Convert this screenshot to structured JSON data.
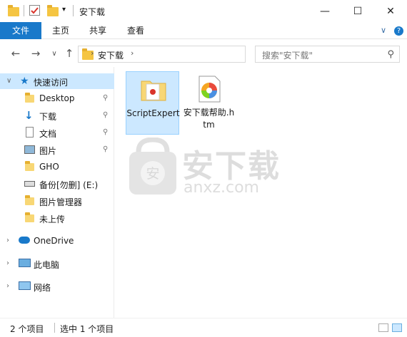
{
  "window": {
    "title": "安下载",
    "minimize_glyph": "—",
    "maximize_glyph": "☐",
    "close_glyph": "✕"
  },
  "ribbon": {
    "tabs": [
      "文件",
      "主页",
      "共享",
      "查看"
    ],
    "expand_glyph": "∨",
    "help_glyph": "?"
  },
  "address": {
    "crumb": "安下载",
    "search_placeholder": "搜索\"安下载\""
  },
  "sidebar": {
    "quick_access": "快速访问",
    "items": [
      {
        "label": "Desktop",
        "icon": "folder-icon",
        "pinned": true
      },
      {
        "label": "下载",
        "icon": "download-arrow-icon",
        "pinned": true
      },
      {
        "label": "文档",
        "icon": "document-icon",
        "pinned": true
      },
      {
        "label": "图片",
        "icon": "pictures-icon",
        "pinned": true
      },
      {
        "label": "GHO",
        "icon": "folder-icon",
        "pinned": false
      },
      {
        "label": "备份[勿删] (E:)",
        "icon": "drive-icon",
        "pinned": false
      },
      {
        "label": "图片管理器",
        "icon": "folder-icon",
        "pinned": false
      },
      {
        "label": "未上传",
        "icon": "folder-icon",
        "pinned": false
      }
    ],
    "onedrive": "OneDrive",
    "this_pc": "此电脑",
    "network": "网络"
  },
  "files": [
    {
      "name": "ScriptExpert",
      "icon": "folder-icon",
      "selected": true
    },
    {
      "name": "安下载帮助.htm",
      "icon": "htm-file-icon",
      "selected": false
    }
  ],
  "watermark": {
    "title": "安下载",
    "subtitle": "anxz.com",
    "shield_char": "安"
  },
  "status": {
    "count": "2 个项目",
    "selected": "选中 1 个项目"
  }
}
